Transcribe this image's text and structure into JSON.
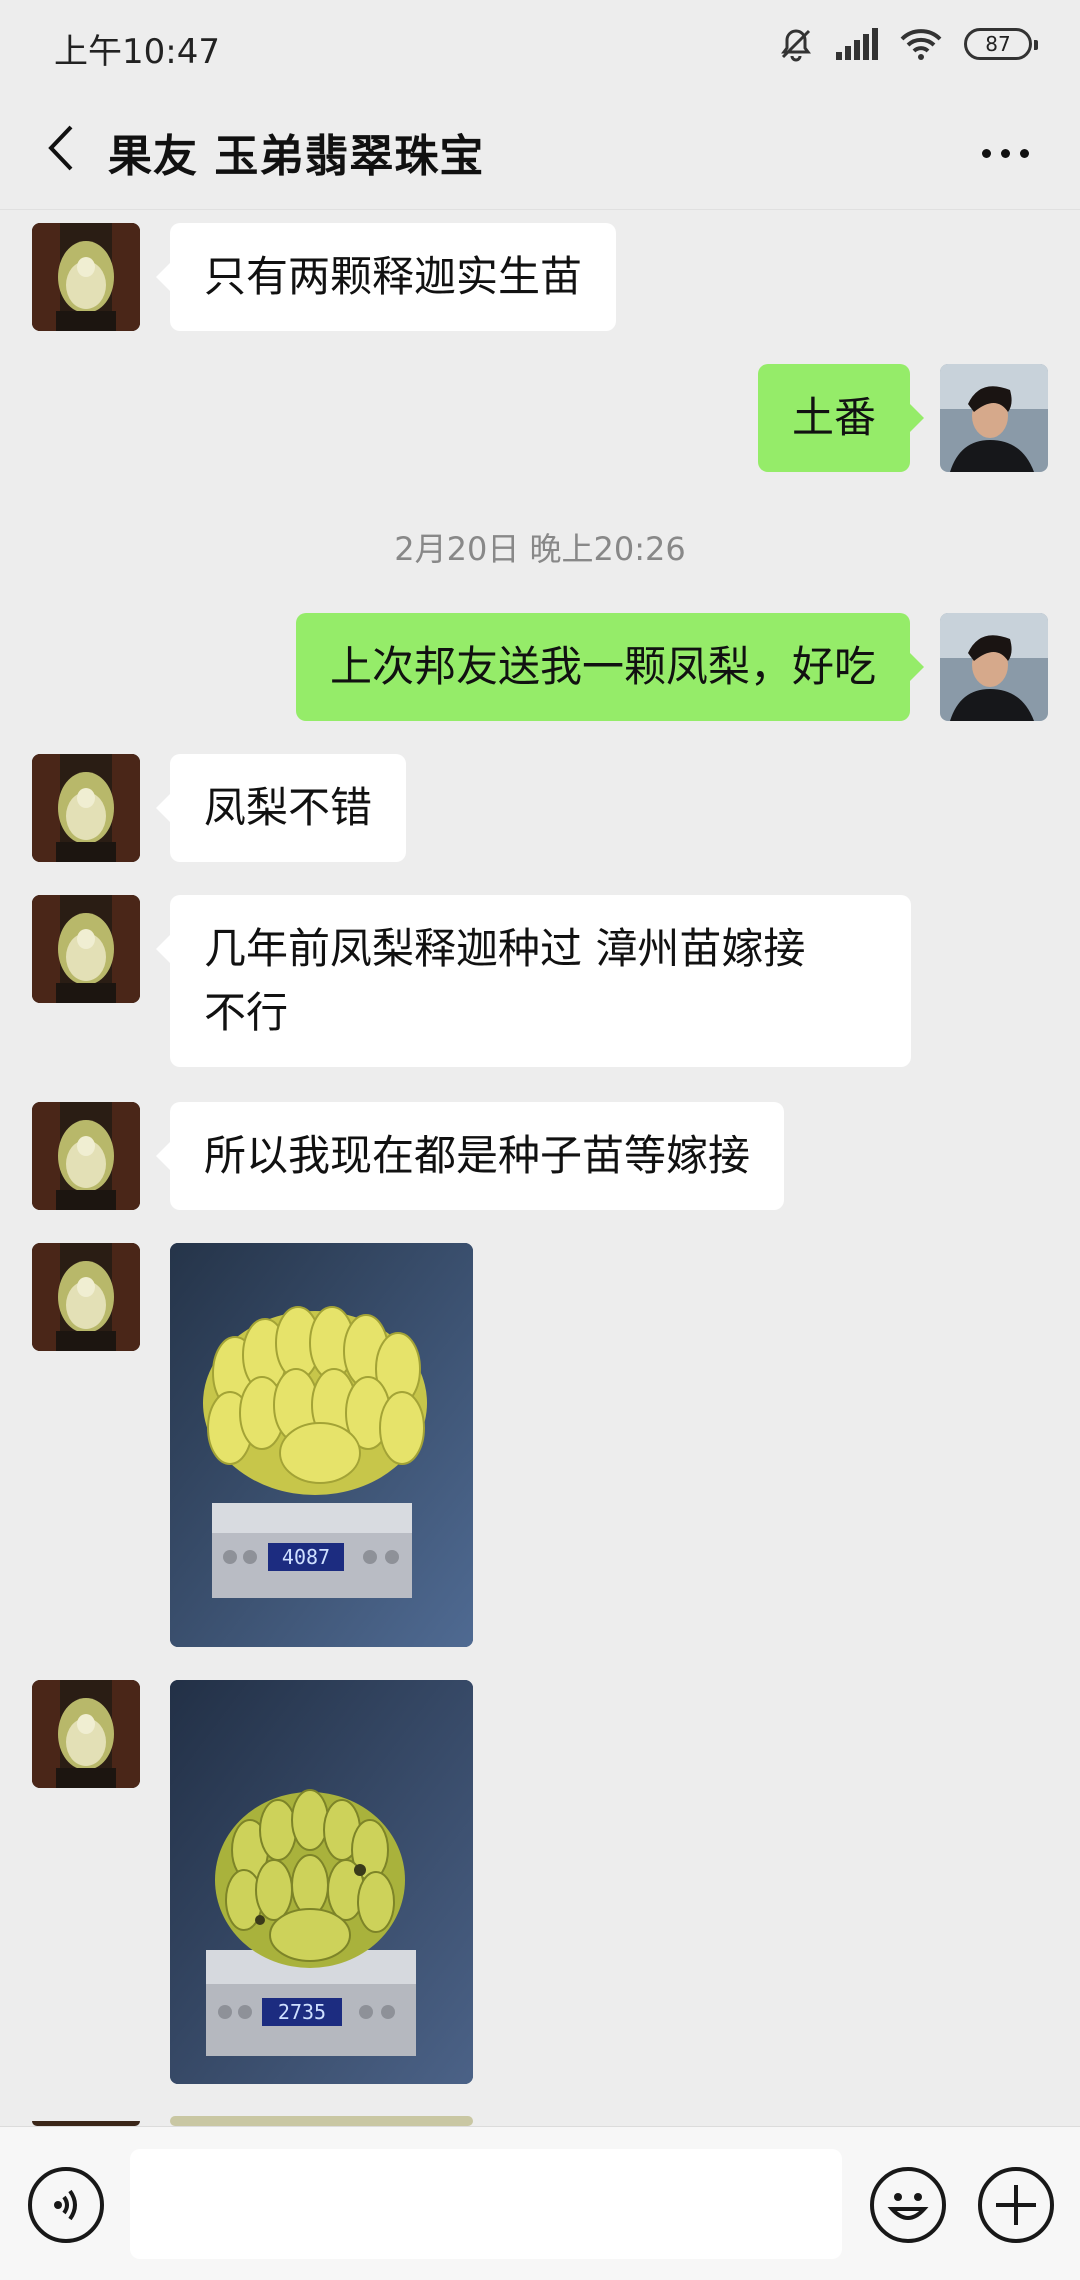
{
  "status_bar": {
    "time": "上午10:47",
    "battery": "87"
  },
  "nav": {
    "title": "果友 玉弟翡翠珠宝",
    "back_icon": "chevron-left-icon",
    "more_icon": "more-dots-icon"
  },
  "messages": [
    {
      "side": "left",
      "type": "text",
      "text": "只有两颗释迦实生苗"
    },
    {
      "side": "right",
      "type": "text",
      "text": "土番"
    },
    {
      "type": "timestamp",
      "text": "2月20日 晚上20:26"
    },
    {
      "side": "right",
      "type": "text",
      "text": "上次邦友送我一颗凤梨，好吃"
    },
    {
      "side": "left",
      "type": "text",
      "text": "凤梨不错"
    },
    {
      "side": "left",
      "type": "text",
      "text": "几年前凤梨释迦种过 漳州苗嫁接\n不行"
    },
    {
      "side": "left",
      "type": "text",
      "text": "所以我现在都是种子苗等嫁接"
    },
    {
      "side": "left",
      "type": "image",
      "scale_reading": "4087"
    },
    {
      "side": "left",
      "type": "image",
      "scale_reading": "2735"
    }
  ],
  "input_bar": {
    "voice_icon": "voice-icon",
    "emoji_icon": "emoji-icon",
    "plus_icon": "plus-icon",
    "input_value": ""
  },
  "colors": {
    "background": "#ededed",
    "bubble_self": "#95ec69",
    "bubble_other": "#ffffff"
  }
}
